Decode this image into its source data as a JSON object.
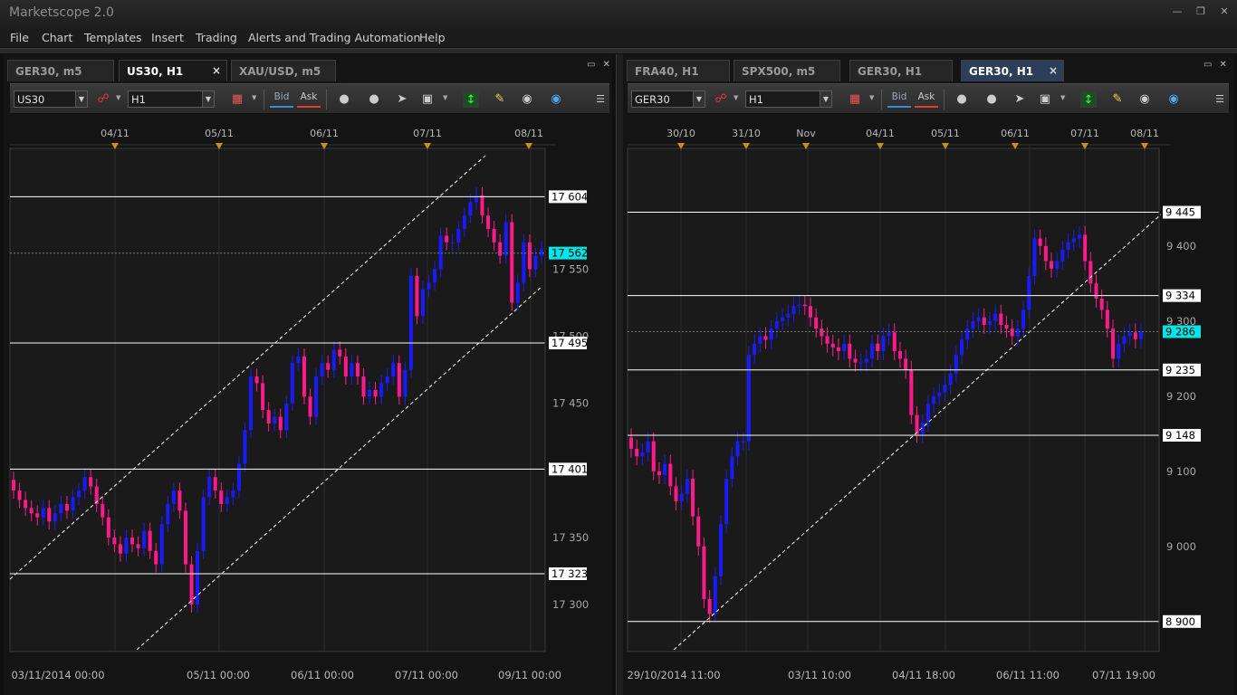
{
  "app": {
    "title": "Marketscope 2.0"
  },
  "menu": [
    "File",
    "Chart",
    "Templates",
    "Insert",
    "Trading",
    "Alerts and Trading Automation",
    "Help"
  ],
  "left_panel": {
    "tabs": [
      {
        "label": "GER30, m5"
      },
      {
        "label": "US30, H1",
        "close": "×"
      },
      {
        "label": "XAU/USD, m5"
      }
    ],
    "toolbar": {
      "instrument": "US30",
      "timeframe": "H1",
      "bid": "Bid",
      "ask": "Ask"
    }
  },
  "right_panel": {
    "tabs": [
      {
        "label": "FRA40, H1"
      },
      {
        "label": "SPX500, m5"
      },
      {
        "label": "GER30, H1"
      },
      {
        "label": "GER30, H1",
        "close": "×"
      }
    ],
    "toolbar": {
      "instrument": "GER30",
      "timeframe": "H1",
      "bid": "Bid",
      "ask": "Ask"
    }
  },
  "chart_data": [
    {
      "type": "candlestick",
      "instrument": "US30",
      "timeframe": "H1",
      "top_date_labels": [
        "04/11",
        "05/11",
        "06/11",
        "07/11",
        "08/11"
      ],
      "bottom_date_labels": [
        "03/11/2014 00:00",
        "05/11 00:00",
        "06/11 00:00",
        "07/11 00:00",
        "09/11 00:00"
      ],
      "y_tick_labels": [
        "17 550",
        "17 500",
        "17 450",
        "17 350",
        "17 300"
      ],
      "ylim": [
        17265,
        17640
      ],
      "current_price": "17 562",
      "current_price_color": "#00e6e6",
      "levels": [
        {
          "label": "17 604",
          "value": 17604
        },
        {
          "label": "17 495",
          "value": 17495
        },
        {
          "label": "17 401",
          "value": 17401
        },
        {
          "label": "17 323",
          "value": 17323
        }
      ],
      "up_color": "#1a1aff",
      "down_color": "#ff1a8c",
      "closes": [
        17385,
        17378,
        17372,
        17368,
        17365,
        17372,
        17362,
        17368,
        17375,
        17370,
        17380,
        17385,
        17395,
        17388,
        17375,
        17365,
        17350,
        17345,
        17338,
        17350,
        17345,
        17342,
        17355,
        17340,
        17330,
        17360,
        17375,
        17385,
        17370,
        17330,
        17300,
        17340,
        17380,
        17395,
        17385,
        17375,
        17380,
        17385,
        17405,
        17430,
        17470,
        17465,
        17445,
        17435,
        17440,
        17430,
        17450,
        17480,
        17485,
        17455,
        17440,
        17470,
        17480,
        17475,
        17490,
        17485,
        17470,
        17480,
        17470,
        17455,
        17460,
        17455,
        17465,
        17470,
        17480,
        17455,
        17475,
        17545,
        17515,
        17535,
        17540,
        17550,
        17575,
        17570,
        17570,
        17580,
        17590,
        17600,
        17605,
        17590,
        17580,
        17570,
        17560,
        17585,
        17525,
        17540,
        17570,
        17550,
        17560,
        17565
      ]
    },
    {
      "type": "candlestick",
      "instrument": "GER30",
      "timeframe": "H1",
      "top_date_labels": [
        "30/10",
        "31/10",
        "Nov",
        "04/11",
        "05/11",
        "06/11",
        "07/11",
        "08/11"
      ],
      "bottom_date_labels": [
        "29/10/2014 11:00",
        "03/11 10:00",
        "04/11 18:00",
        "06/11 11:00",
        "07/11 19:00"
      ],
      "y_tick_labels": [
        "9 400",
        "9 300",
        "9 200",
        "9 100",
        "9 000"
      ],
      "ylim": [
        8860,
        9530
      ],
      "current_price": "9 286",
      "current_price_color": "#00e6e6",
      "levels": [
        {
          "label": "9 445",
          "value": 9445
        },
        {
          "label": "9 334",
          "value": 9334
        },
        {
          "label": "9 235",
          "value": 9235
        },
        {
          "label": "9 148",
          "value": 9148
        },
        {
          "label": "8 900",
          "value": 8900
        }
      ],
      "up_color": "#1a1aff",
      "down_color": "#ff1a8c",
      "closes": [
        9130,
        9120,
        9125,
        9140,
        9100,
        9095,
        9110,
        9080,
        9060,
        9070,
        9090,
        9040,
        9000,
        8930,
        8910,
        8960,
        9030,
        9090,
        9120,
        9140,
        9140,
        9255,
        9270,
        9280,
        9275,
        9290,
        9300,
        9305,
        9310,
        9320,
        9322,
        9320,
        9305,
        9290,
        9280,
        9270,
        9265,
        9260,
        9270,
        9250,
        9245,
        9245,
        9250,
        9270,
        9260,
        9280,
        9285,
        9260,
        9250,
        9235,
        9175,
        9150,
        9165,
        9190,
        9200,
        9205,
        9215,
        9230,
        9255,
        9275,
        9290,
        9300,
        9305,
        9295,
        9300,
        9310,
        9295,
        9290,
        9280,
        9290,
        9315,
        9360,
        9410,
        9400,
        9380,
        9370,
        9380,
        9395,
        9405,
        9410,
        9415,
        9380,
        9350,
        9330,
        9315,
        9290,
        9250,
        9270,
        9280,
        9285,
        9276,
        9286
      ]
    }
  ]
}
